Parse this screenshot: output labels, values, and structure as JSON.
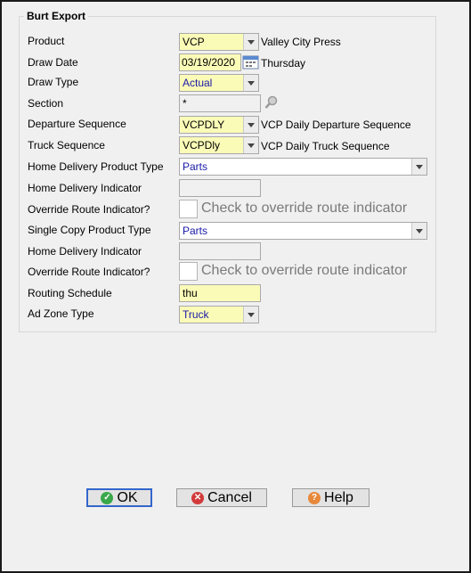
{
  "group": {
    "title": "Burt Export"
  },
  "fields": {
    "product": {
      "label": "Product",
      "value": "VCP",
      "desc": "Valley City Press"
    },
    "draw_date": {
      "label": "Draw Date",
      "value": "03/19/2020",
      "desc": "Thursday"
    },
    "draw_type": {
      "label": "Draw Type",
      "value": "Actual"
    },
    "section": {
      "label": "Section",
      "value": "*"
    },
    "departure_sequence": {
      "label": "Departure Sequence",
      "value": "VCPDLY",
      "desc": "VCP Daily Departure Sequence"
    },
    "truck_sequence": {
      "label": "Truck Sequence",
      "value": "VCPDly",
      "desc": "VCP Daily Truck Sequence"
    },
    "hd_product_type": {
      "label": "Home Delivery Product Type",
      "value": "Parts"
    },
    "hd_indicator": {
      "label": "Home Delivery Indicator",
      "value": ""
    },
    "override_route_1": {
      "label": "Override Route Indicator?",
      "check_text": "Check to override route indicator"
    },
    "sc_product_type": {
      "label": "Single Copy Product Type",
      "value": "Parts"
    },
    "hd_indicator_2": {
      "label": "Home Delivery Indicator",
      "value": ""
    },
    "override_route_2": {
      "label": "Override Route Indicator?",
      "check_text": "Check to override route indicator"
    },
    "routing_schedule": {
      "label": "Routing Schedule",
      "value": "thu"
    },
    "ad_zone_type": {
      "label": "Ad Zone Type",
      "value": "Truck"
    }
  },
  "buttons": {
    "ok": "OK",
    "cancel": "Cancel",
    "help": "Help"
  },
  "colors": {
    "required_bg": "#fbfbb8",
    "value_text": "#1a1aa8",
    "default_border": "#3366cc"
  }
}
